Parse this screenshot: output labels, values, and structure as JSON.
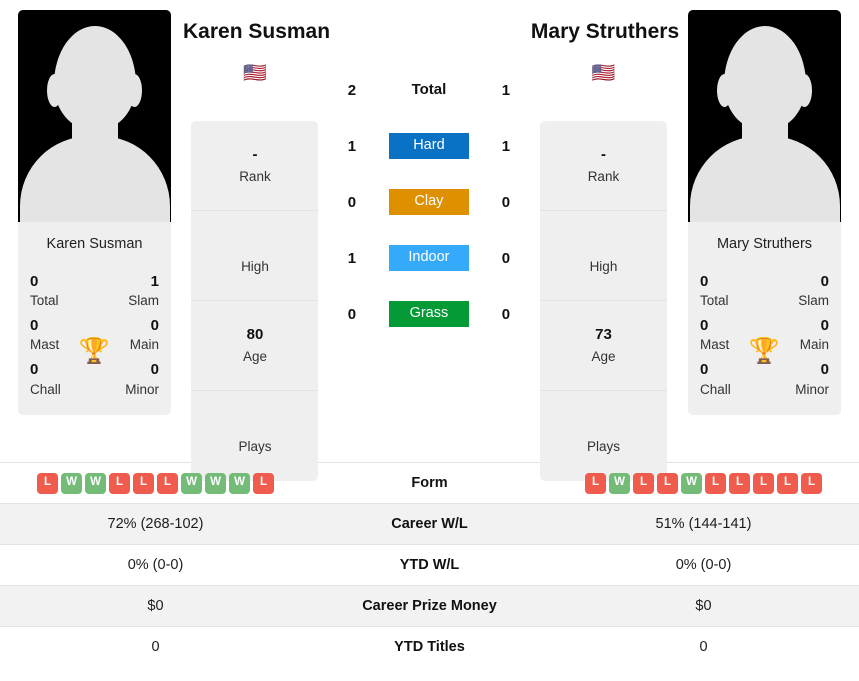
{
  "players": {
    "left": {
      "name": "Karen Susman",
      "photo_caption": "Karen Susman",
      "flag": "🇺🇸",
      "flag_name": "united-states-flag",
      "titles": {
        "total_value": "0",
        "total_label": "Total",
        "slam_value": "1",
        "slam_label": "Slam",
        "mast_value": "0",
        "mast_label": "Mast",
        "main_value": "0",
        "main_label": "Main",
        "chall_value": "0",
        "chall_label": "Chall",
        "minor_value": "0",
        "minor_label": "Minor"
      },
      "info": {
        "rank_value": "-",
        "rank_label": "Rank",
        "high_value": "",
        "high_label": "High",
        "age_value": "80",
        "age_label": "Age",
        "plays_value": "",
        "plays_label": "Plays"
      },
      "form": [
        "L",
        "W",
        "W",
        "L",
        "L",
        "L",
        "W",
        "W",
        "W",
        "L"
      ],
      "career_wl": "72% (268-102)",
      "ytd_wl": "0% (0-0)",
      "career_prize_money": "$0",
      "ytd_titles": "0"
    },
    "right": {
      "name": "Mary Struthers",
      "photo_caption": "Mary Struthers",
      "flag": "🇺🇸",
      "flag_name": "united-states-flag",
      "titles": {
        "total_value": "0",
        "total_label": "Total",
        "slam_value": "0",
        "slam_label": "Slam",
        "mast_value": "0",
        "mast_label": "Mast",
        "main_value": "0",
        "main_label": "Main",
        "chall_value": "0",
        "chall_label": "Chall",
        "minor_value": "0",
        "minor_label": "Minor"
      },
      "info": {
        "rank_value": "-",
        "rank_label": "Rank",
        "high_value": "",
        "high_label": "High",
        "age_value": "73",
        "age_label": "Age",
        "plays_value": "",
        "plays_label": "Plays"
      },
      "form": [
        "L",
        "W",
        "L",
        "L",
        "W",
        "L",
        "L",
        "L",
        "L",
        "L"
      ],
      "career_wl": "51% (144-141)",
      "ytd_wl": "0% (0-0)",
      "career_prize_money": "$0",
      "ytd_titles": "0"
    }
  },
  "head_to_head": {
    "total": {
      "label": "Total",
      "left": "2",
      "right": "1"
    },
    "surfaces": [
      {
        "label": "Hard",
        "color": "#0A72C4",
        "left": "1",
        "right": "1"
      },
      {
        "label": "Clay",
        "color": "#DF9000",
        "left": "0",
        "right": "0"
      },
      {
        "label": "Indoor",
        "color": "#35A9FA",
        "left": "1",
        "right": "0"
      },
      {
        "label": "Grass",
        "color": "#049A36",
        "left": "0",
        "right": "0"
      }
    ]
  },
  "table": {
    "rows": [
      {
        "label": "Form"
      },
      {
        "label": "Career W/L"
      },
      {
        "label": "YTD W/L"
      },
      {
        "label": "Career Prize Money"
      },
      {
        "label": "YTD Titles"
      }
    ]
  },
  "trophy_icon": "🏆",
  "colors": {
    "win": "#73bb77",
    "loss": "#ef5b4c",
    "card_bg": "#efefef",
    "row_shade": "#f2f2f2"
  }
}
